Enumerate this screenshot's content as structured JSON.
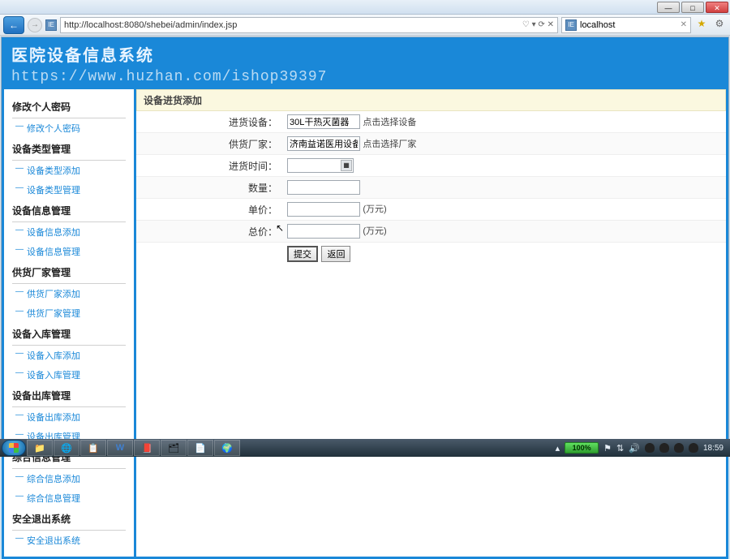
{
  "window": {
    "min": "—",
    "max": "□",
    "close": "✕"
  },
  "browser": {
    "url": "http://localhost:8080/shebei/admin/index.jsp",
    "tab_label": "localhost",
    "controls": "♡ ▾ ⟳ ✕"
  },
  "app": {
    "title": "医院设备信息系统",
    "watermark": "https://www.huzhan.com/ishop39397"
  },
  "sidebar": {
    "groups": [
      {
        "title": "修改个人密码",
        "items": [
          "修改个人密码"
        ]
      },
      {
        "title": "设备类型管理",
        "items": [
          "设备类型添加",
          "设备类型管理"
        ]
      },
      {
        "title": "设备信息管理",
        "items": [
          "设备信息添加",
          "设备信息管理"
        ]
      },
      {
        "title": "供货厂家管理",
        "items": [
          "供货厂家添加",
          "供货厂家管理"
        ]
      },
      {
        "title": "设备入库管理",
        "items": [
          "设备入库添加",
          "设备入库管理"
        ]
      },
      {
        "title": "设备出库管理",
        "items": [
          "设备出库添加",
          "设备出库管理"
        ]
      },
      {
        "title": "综合信息管理",
        "items": [
          "综合信息添加",
          "综合信息管理"
        ]
      },
      {
        "title": "安全退出系统",
        "items": [
          "安全退出系统"
        ]
      }
    ]
  },
  "form": {
    "title": "设备进货添加",
    "rows": {
      "device_label": "进货设备：",
      "device_value": "30L干热灭菌器",
      "device_hint": "点击选择设备",
      "supplier_label": "供货厂家：",
      "supplier_value": "济南益诺医用设备有限公",
      "supplier_hint": "点击选择厂家",
      "time_label": "进货时间：",
      "time_value": "",
      "qty_label": "数量：",
      "qty_value": "",
      "unitprice_label": "单价：",
      "unitprice_value": "",
      "unitprice_unit": "(万元)",
      "total_label": "总价：",
      "total_value": "",
      "total_unit": "(万元)"
    },
    "buttons": {
      "submit": "提交",
      "back": "返回"
    }
  },
  "taskbar": {
    "items": [
      "📁",
      "🌐",
      "📋",
      "W",
      "📕",
      "🗂",
      "📄",
      "🌍"
    ],
    "battery": "100%",
    "clock": "18:59"
  }
}
